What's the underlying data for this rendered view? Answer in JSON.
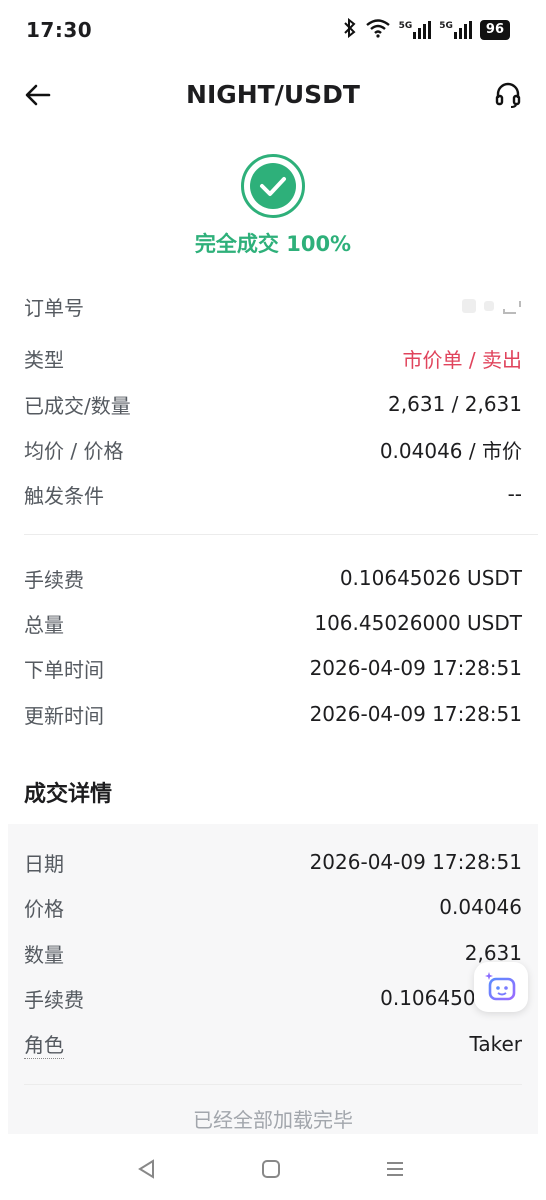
{
  "status_bar": {
    "time": "17:30",
    "signal_label_1": "5G",
    "signal_label_2": "5G",
    "battery": "96"
  },
  "header": {
    "title": "NIGHT/USDT",
    "back_icon": "arrow-left-icon",
    "support_icon": "headset-icon"
  },
  "status": {
    "text": "完全成交 100%",
    "color": "#2eb07a"
  },
  "order_info": {
    "order_id_label": "订单号",
    "type_label": "类型",
    "type_value": "市价单 / 卖出",
    "filled_label": "已成交/数量",
    "filled_value": "2,631 / 2,631",
    "avg_price_label": "均价 / 价格",
    "avg_price_value": "0.04046 / 市价",
    "trigger_label": "触发条件",
    "trigger_value": "--"
  },
  "fee_info": {
    "fee_label": "手续费",
    "fee_value": "0.10645026 USDT",
    "total_label": "总量",
    "total_value": "106.45026000 USDT",
    "created_label": "下单时间",
    "created_value": "2026-04-09 17:28:51",
    "updated_label": "更新时间",
    "updated_value": "2026-04-09 17:28:51"
  },
  "trade_details": {
    "section_title": "成交详情",
    "date_label": "日期",
    "date_value": "2026-04-09 17:28:51",
    "price_label": "价格",
    "price_value": "0.04046",
    "qty_label": "数量",
    "qty_value": "2,631",
    "fee_label": "手续费",
    "fee_value": "0.10645026 U",
    "role_label": "角色",
    "role_value": "Taker"
  },
  "footer": {
    "loaded_text": "已经全部加载完毕"
  },
  "colors": {
    "accent_green": "#2eb07a",
    "sell_red": "#e0445c"
  }
}
